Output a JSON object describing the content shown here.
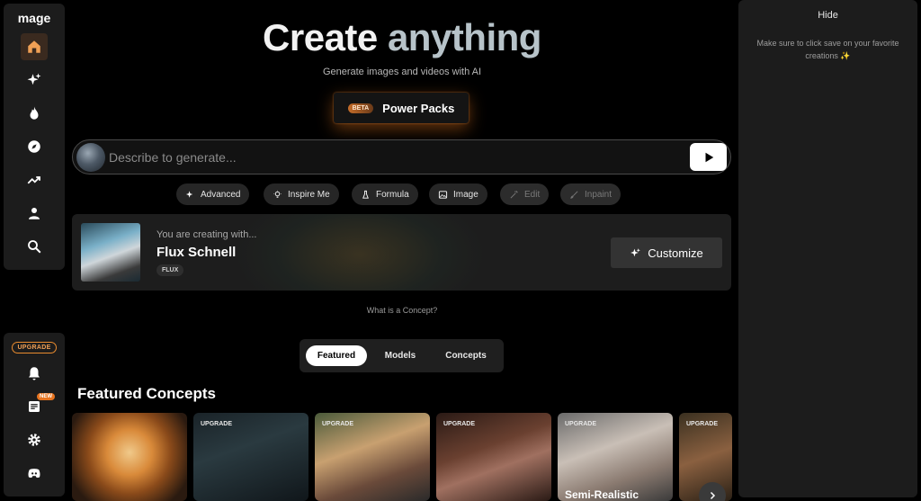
{
  "sidebar": {
    "logo": "mage",
    "upgrade_label": "UPGRADE",
    "new_badge": "NEW",
    "top_items": [
      "home-icon",
      "sparkles-icon",
      "flame-icon",
      "compass-icon",
      "trending-icon",
      "user-icon",
      "search-icon"
    ],
    "bottom_items": [
      "bell-icon",
      "news-icon",
      "gear-icon",
      "discord-icon"
    ],
    "accent": "#e98b2e"
  },
  "hero": {
    "title_word1": "Create",
    "title_word2": "anything",
    "subtitle": "Generate images and videos with AI",
    "beta_tag": "BETA",
    "power_label": "Power Packs"
  },
  "prompt": {
    "placeholder": "Describe to generate..."
  },
  "chips": [
    {
      "label": "Advanced",
      "icon": "sparkles-icon",
      "disabled": false
    },
    {
      "label": "Inspire Me",
      "icon": "bulb-icon",
      "disabled": false
    },
    {
      "label": "Formula",
      "icon": "flask-icon",
      "disabled": false
    },
    {
      "label": "Image",
      "icon": "image-icon",
      "disabled": false
    },
    {
      "label": "Edit",
      "icon": "wand-icon",
      "disabled": true
    },
    {
      "label": "Inpaint",
      "icon": "brush-icon",
      "disabled": true
    }
  ],
  "model": {
    "subtitle": "You are creating with...",
    "name": "Flux Schnell",
    "tag": "FLUX",
    "customize_label": "Customize"
  },
  "concept_link": "What is a Concept?",
  "tabs": [
    {
      "label": "Featured",
      "active": true
    },
    {
      "label": "Models",
      "active": false
    },
    {
      "label": "Concepts",
      "active": false
    }
  ],
  "section_title": "Featured Concepts",
  "concepts": [
    {
      "badge": "",
      "name": ""
    },
    {
      "badge": "UPGRADE",
      "name": ""
    },
    {
      "badge": "UPGRADE",
      "name": ""
    },
    {
      "badge": "UPGRADE",
      "name": ""
    },
    {
      "badge": "UPGRADE",
      "name": "Semi-Realistic"
    },
    {
      "badge": "UPGRADE",
      "name": ""
    }
  ],
  "right_panel": {
    "hide_label": "Hide",
    "message": "Make sure to click save on your favorite creations ✨"
  }
}
